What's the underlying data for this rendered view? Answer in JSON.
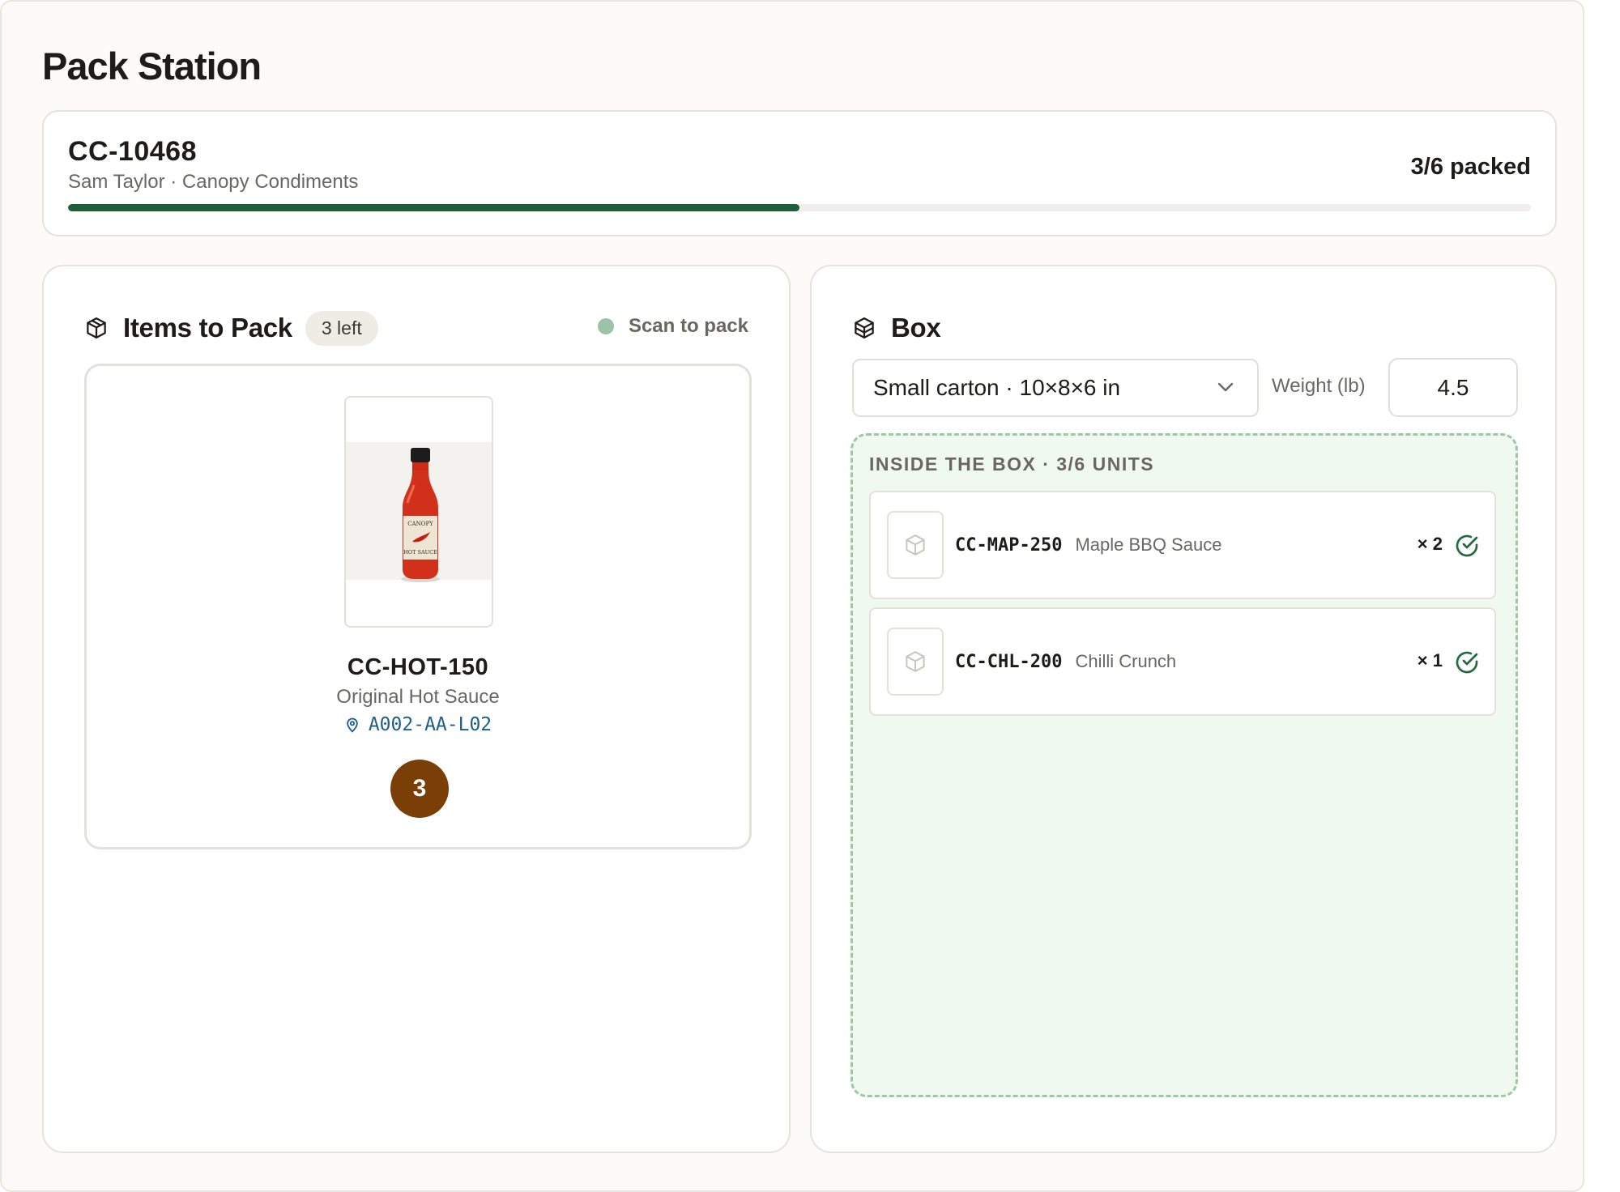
{
  "page": {
    "title": "Pack Station"
  },
  "order": {
    "id": "CC-10468",
    "subtitle": "Sam Taylor · Canopy Condiments",
    "progress_text": "3/6 packed",
    "progress_fraction": 0.5,
    "progress_color": "#1f5e3b"
  },
  "items_panel": {
    "title": "Items to Pack",
    "badge": "3 left",
    "scan_hint": "Scan to pack",
    "icon": "package-icon",
    "current_item": {
      "sku": "CC-HOT-150",
      "name": "Original Hot Sauce",
      "location": "A002-AA-L02",
      "quantity": "3",
      "image_text_top": "CANOPY",
      "image_text_bottom": "HOT SAUCE"
    }
  },
  "box_panel": {
    "title": "Box",
    "icon": "boxes-icon",
    "box_type": "Small carton · 10×8×6 in",
    "weight_label": "Weight (lb)",
    "weight_value": "4.5",
    "dropzone_label": "INSIDE THE BOX · 3/6 UNITS",
    "packed_items": [
      {
        "sku": "CC-MAP-250",
        "name": "Maple BBQ Sauce",
        "qty": "× 2"
      },
      {
        "sku": "CC-CHL-200",
        "name": "Chilli Crunch",
        "qty": "× 1"
      }
    ]
  },
  "colors": {
    "accent_green": "#1f5e3b",
    "qty_brown": "#7a3f06",
    "location_blue": "#1d5f8a",
    "dropzone_bg": "#f0f9f0"
  }
}
